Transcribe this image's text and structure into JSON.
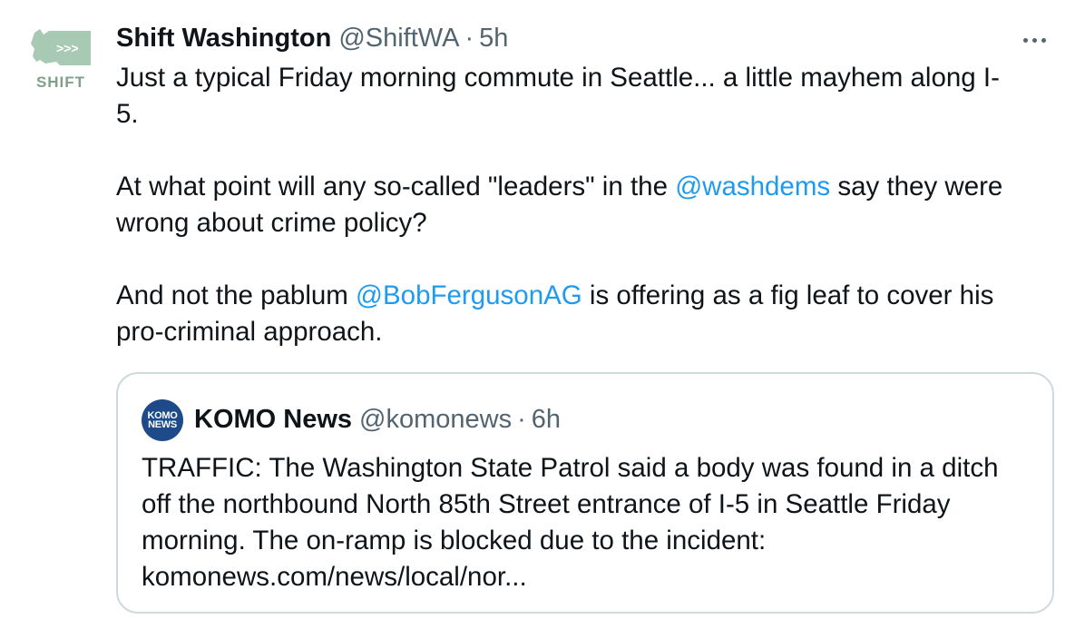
{
  "tweet": {
    "author": {
      "display_name": "Shift Washington",
      "handle": "@ShiftWA",
      "time": "5h",
      "avatar_label": "SHIFT",
      "avatar_icon": "washington-state-map-icon"
    },
    "separator": "·",
    "more_icon": "more-horizontal-icon",
    "lines": {
      "l1": "Just a typical Friday morning commute in Seattle... a little mayhem along I-",
      "l2": "5.",
      "l3_pre": "At what point will any so-called \"leaders\" in the ",
      "l3_mention": "@washdems",
      "l3_post": " say they were",
      "l4": "wrong about crime policy?",
      "l5_pre": "And not the pablum ",
      "l5_mention": "@BobFergusonAG",
      "l5_post": " is offering as a fig leaf to cover his",
      "l6": "pro-criminal approach."
    }
  },
  "quote": {
    "author": {
      "display_name": "KOMO News",
      "handle": "@komonews",
      "time": "6h",
      "avatar_line1": "KOMO",
      "avatar_line2": "NEWS"
    },
    "lines": [
      "TRAFFIC: The Washington State Patrol said a body was found in a ditch",
      "off the northbound North 85th Street entrance of I-5 in Seattle Friday",
      "morning. The on-ramp is blocked due to the incident:",
      "komonews.com/news/local/nor..."
    ]
  },
  "colors": {
    "mention": "#1d9bf0",
    "secondary_text": "#536471",
    "border": "#cfd9de",
    "avatar_green": "#a8c9b4",
    "avatar_label": "#7fa08b",
    "komo_blue": "#1f4a8a"
  }
}
